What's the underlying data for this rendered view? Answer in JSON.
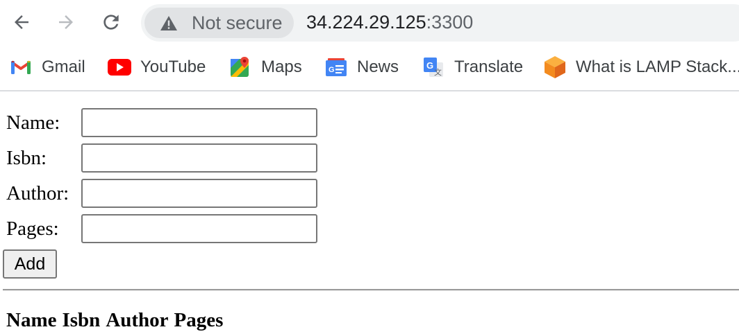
{
  "browser": {
    "security_label": "Not secure",
    "url_host": "34.224.29.125",
    "url_port": ":3300"
  },
  "bookmarks": [
    {
      "label": "Gmail",
      "icon": "gmail-icon"
    },
    {
      "label": "YouTube",
      "icon": "youtube-icon"
    },
    {
      "label": "Maps",
      "icon": "maps-icon"
    },
    {
      "label": "News",
      "icon": "news-icon"
    },
    {
      "label": "Translate",
      "icon": "translate-icon"
    },
    {
      "label": "What is LAMP Stack...",
      "icon": "cube-icon"
    }
  ],
  "form": {
    "name_label": "Name:",
    "name_value": "",
    "isbn_label": "Isbn:",
    "isbn_value": "",
    "author_label": "Author:",
    "author_value": "",
    "pages_label": "Pages:",
    "pages_value": "",
    "add_label": "Add"
  },
  "table": {
    "headers": [
      "Name",
      "Isbn",
      "Author",
      "Pages"
    ]
  },
  "colors": {
    "omnibox_bg": "#f1f3f4",
    "chip_bg": "#e1e3e5",
    "youtube_red": "#ff0000",
    "lamp_orange": "#f38b1f"
  }
}
